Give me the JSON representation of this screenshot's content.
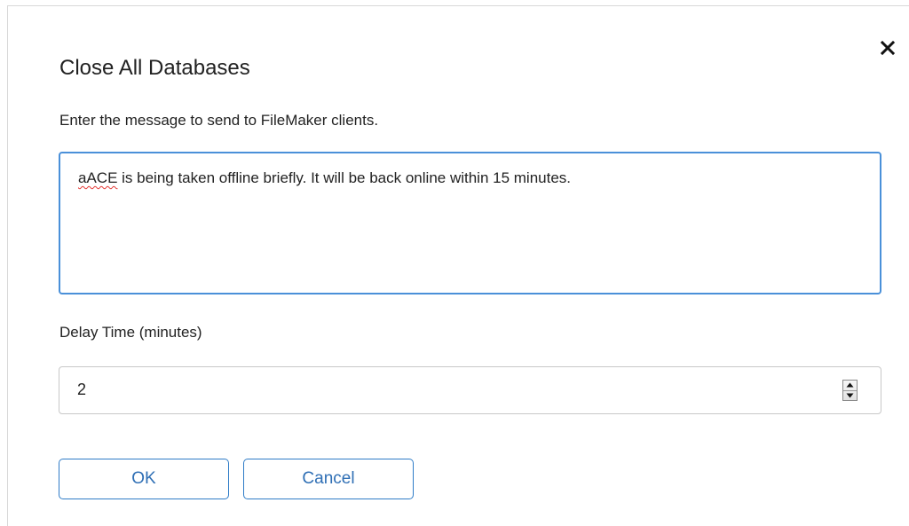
{
  "dialog": {
    "title": "Close All Databases",
    "close_icon": "close-icon",
    "message_label": "Enter the message to send to FileMaker clients.",
    "message": {
      "misspelled_word": "aACE",
      "rest": " is being taken offline briefly. It will be back online within 15 minutes."
    },
    "delay_label": "Delay Time (minutes)",
    "delay_value": "2",
    "spinner_icons": [
      "spinner-up-icon",
      "spinner-down-icon"
    ],
    "buttons": {
      "ok": "OK",
      "cancel": "Cancel"
    }
  },
  "colors": {
    "accent": "#4a90d9",
    "button_text": "#2f6fb5",
    "spellcheck": "#e53935"
  }
}
